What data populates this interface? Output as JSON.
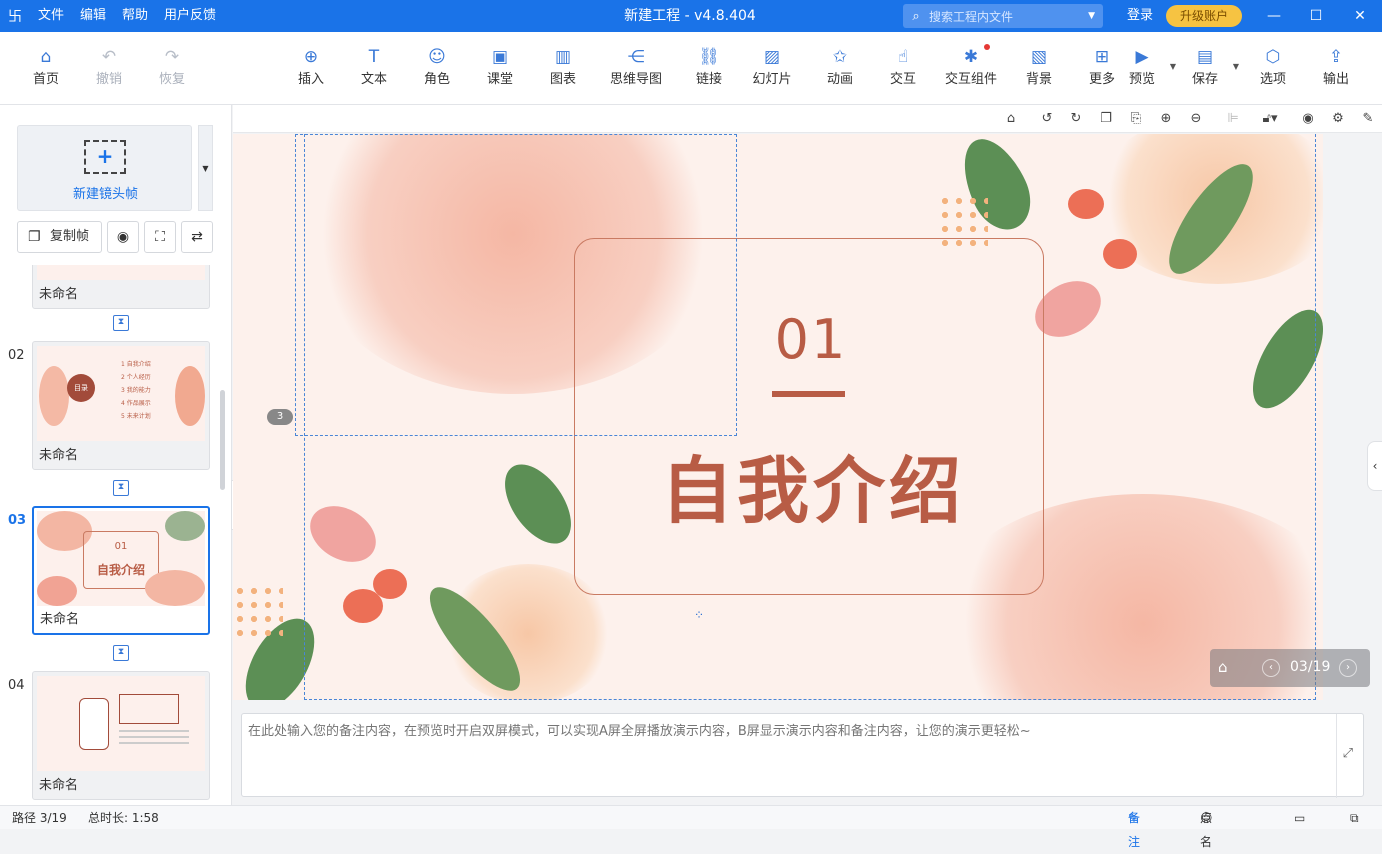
{
  "titlebar": {
    "menu": [
      "文件",
      "编辑",
      "帮助",
      "用户反馈"
    ],
    "window_title": "新建工程 - v4.8.404",
    "search_placeholder": "搜索工程内文件",
    "login": "登录",
    "upgrade": "升级账户"
  },
  "toolbar": {
    "home": "首页",
    "undo": "撤销",
    "redo": "恢复",
    "insert": "插入",
    "text": "文本",
    "role": "角色",
    "class": "课堂",
    "chart": "图表",
    "mindmap": "思维导图",
    "link": "链接",
    "slideshow": "幻灯片",
    "animation": "动画",
    "interact": "交互",
    "interact_widget": "交互组件",
    "background": "背景",
    "more": "更多",
    "preview": "预览",
    "save": "保存",
    "options": "选项",
    "export": "输出"
  },
  "left": {
    "new_frame": "新建镜头帧",
    "copy_frame": "复制帧",
    "slides": [
      {
        "num": "",
        "name": "未命名"
      },
      {
        "num": "02",
        "name": "未命名"
      },
      {
        "num": "03",
        "name": "未命名"
      },
      {
        "num": "04",
        "name": "未命名"
      }
    ],
    "thumb02_items": [
      "1 自我介绍",
      "2 个人经历",
      "3 我的能力",
      "4 作品展示",
      "5 未来计划"
    ],
    "thumb02_title": "目录",
    "thumb03_num": "01",
    "thumb03_title": "自我介绍"
  },
  "slide": {
    "number": "01",
    "title": "自我介绍",
    "path_tag": "3"
  },
  "nav": {
    "page": "03/19"
  },
  "notes": {
    "placeholder": "在此处输入您的备注内容，在预览时开启双屏模式，可以实现A屏全屏播放演示内容，B屏显示演示内容和备注内容，让您的演示更轻松~"
  },
  "status": {
    "path": "路径 3/19",
    "duration": "总时长: 1:58",
    "notes_btn": "备注",
    "rollcall_btn": "点名"
  },
  "colors": {
    "accent": "#1a73e8",
    "slide_text": "#b85c45",
    "upgrade": "#f6c342"
  }
}
